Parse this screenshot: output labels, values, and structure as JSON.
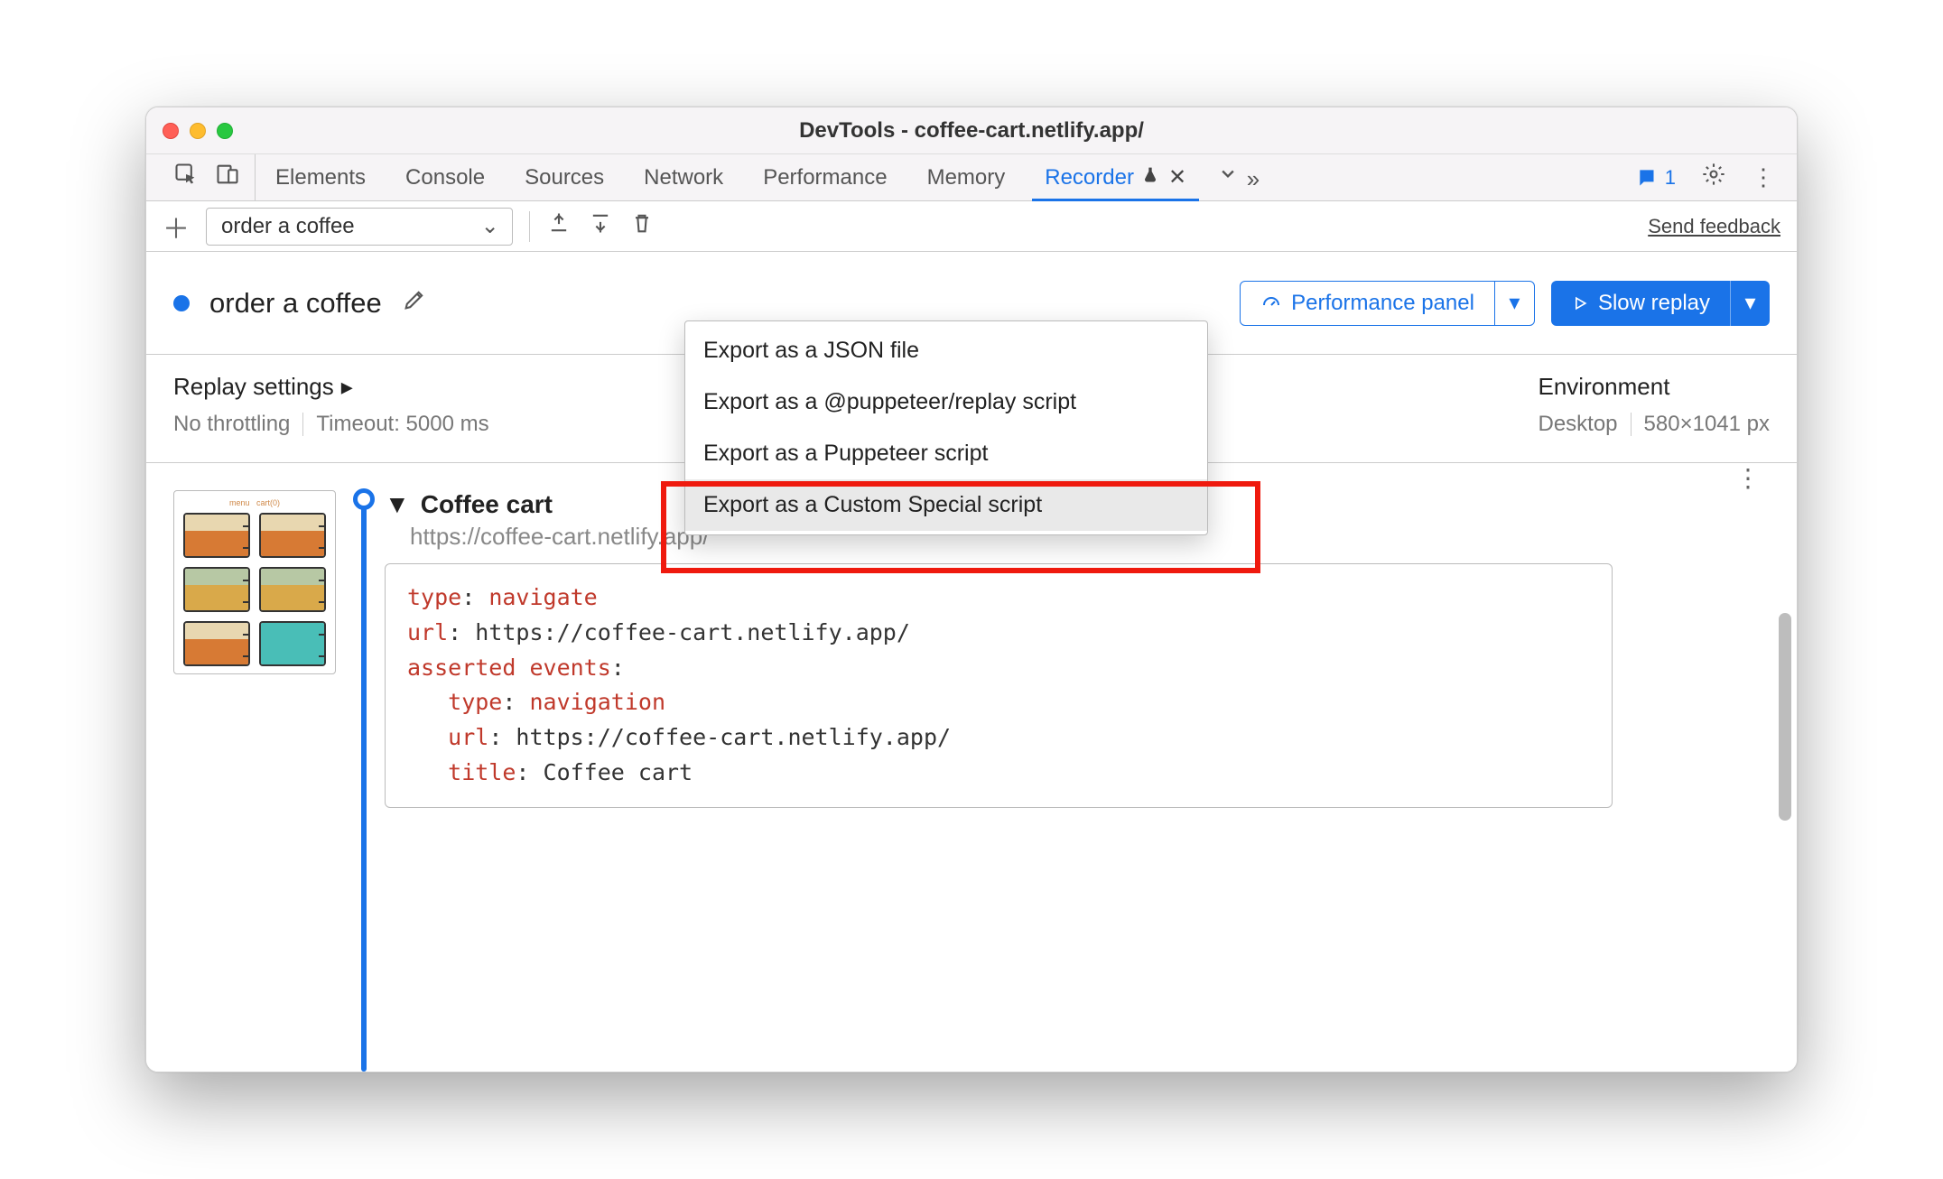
{
  "window": {
    "title": "DevTools - coffee-cart.netlify.app/"
  },
  "tabs": {
    "items": [
      "Elements",
      "Console",
      "Sources",
      "Network",
      "Performance",
      "Memory",
      "Recorder"
    ],
    "active": "Recorder"
  },
  "issues": {
    "count": "1"
  },
  "toolbar": {
    "recording_name": "order a coffee",
    "feedback": "Send feedback"
  },
  "header": {
    "title": "order a coffee",
    "perf_button": "Performance panel",
    "replay_button": "Slow replay"
  },
  "settings": {
    "replay_heading": "Replay settings",
    "throttling": "No throttling",
    "timeout_label": "Timeout: 5000 ms",
    "env_heading": "Environment",
    "env_device": "Desktop",
    "env_viewport": "580×1041 px"
  },
  "export_menu": {
    "items": [
      "Export as a JSON file",
      "Export as a @puppeteer/replay script",
      "Export as a Puppeteer script",
      "Export as a Custom Special script"
    ],
    "highlighted_index": 3
  },
  "step": {
    "title": "Coffee cart",
    "url": "https://coffee-cart.netlify.app/",
    "code": {
      "l1k": "type",
      "l1v": "navigate",
      "l2k": "url",
      "l2v": "https://coffee-cart.netlify.app/",
      "l3k": "asserted events",
      "l4k": "type",
      "l4v": "navigation",
      "l5k": "url",
      "l5v": "https://coffee-cart.netlify.app/",
      "l6k": "title",
      "l6v": "Coffee cart"
    }
  }
}
